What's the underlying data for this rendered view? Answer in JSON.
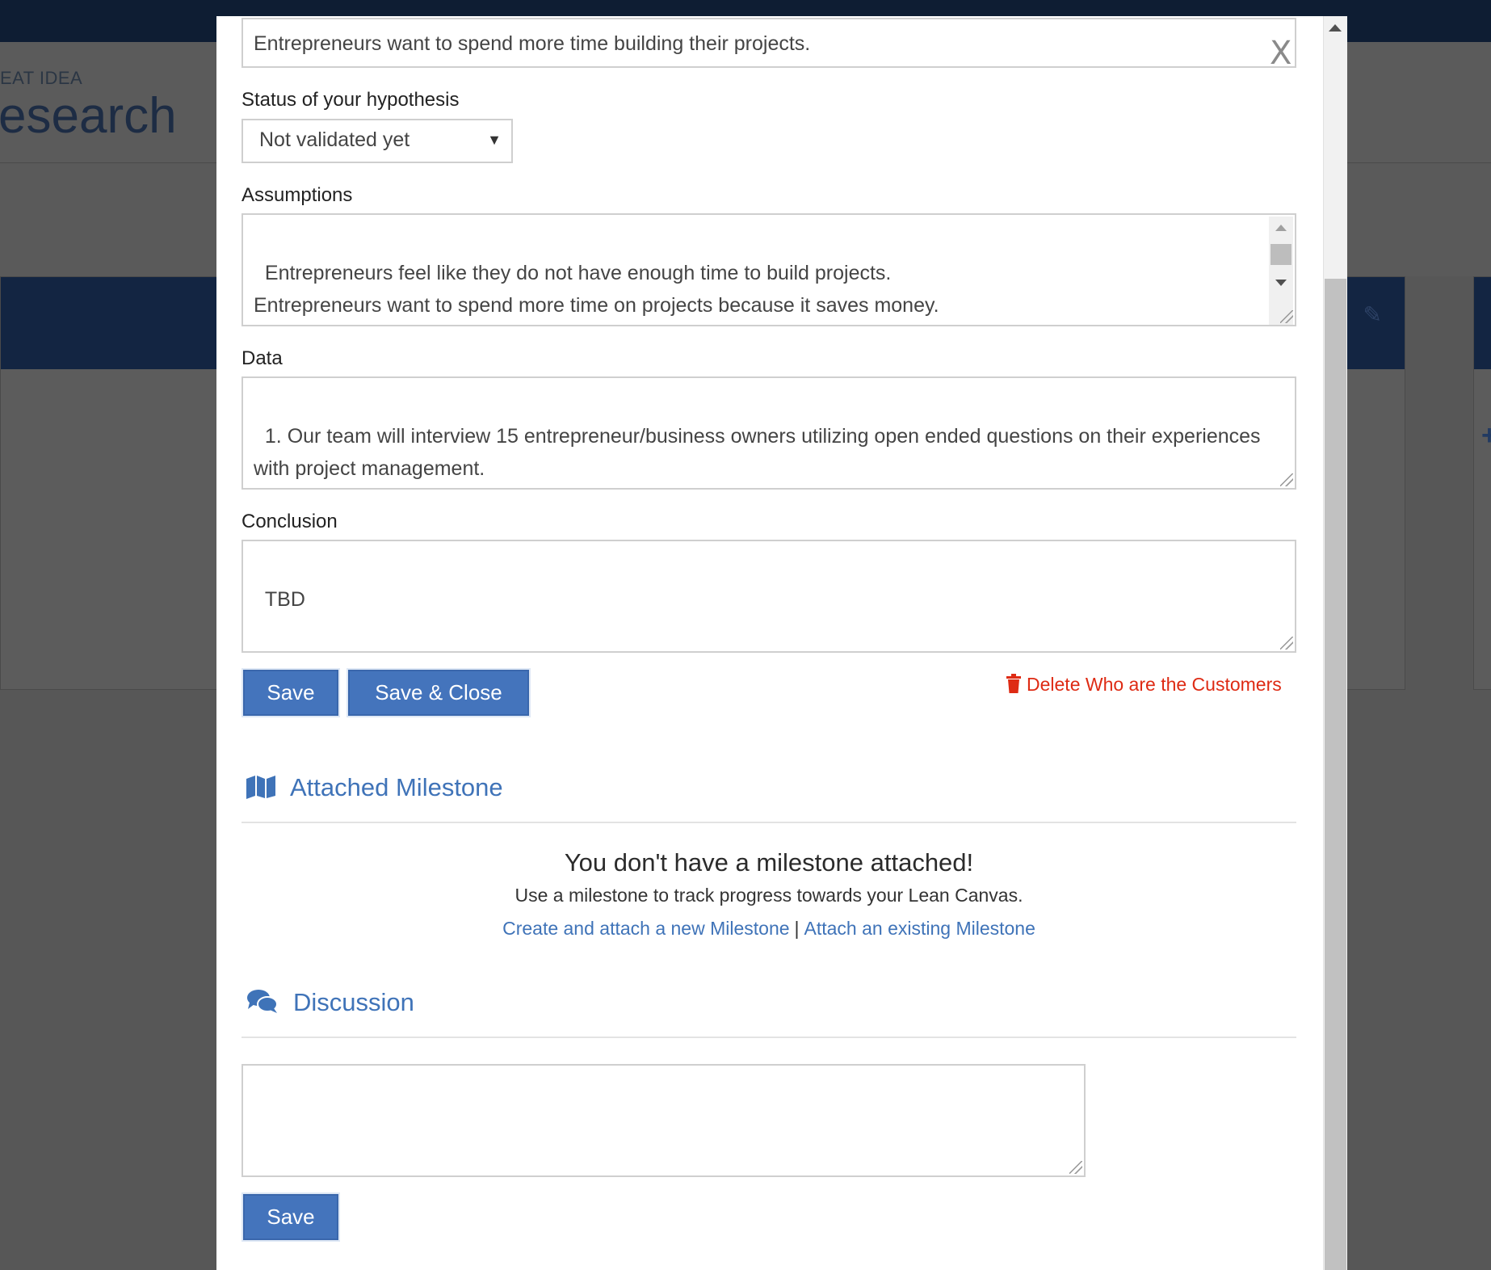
{
  "background": {
    "kicker": "EAT IDEA",
    "title": "esearch"
  },
  "modal": {
    "hypothesis_value": "Entrepreneurs  want to spend more time building their projects.",
    "close_symbol": "X",
    "status": {
      "label": "Status of your hypothesis",
      "selected": "Not validated yet"
    },
    "assumptions": {
      "label": "Assumptions",
      "value": "Entrepreneurs feel like they do not have enough time to build projects.\nEntrepreneurs want to spend more time on projects because it saves money.\nEntrepreneurs find building more enjoyable than planning."
    },
    "data": {
      "label": "Data",
      "value": "1. Our team will interview 15 entrepreneur/business owners utilizing open ended questions on their experiences with project management."
    },
    "conclusion": {
      "label": "Conclusion",
      "value": "TBD"
    },
    "actions": {
      "save": "Save",
      "save_close": "Save & Close",
      "delete": "Delete Who are the Customers"
    },
    "milestone": {
      "heading": "Attached Milestone",
      "empty_title": "You don't have a milestone attached!",
      "empty_sub": "Use a milestone to track progress towards your Lean Canvas.",
      "create_link": "Create and attach a new Milestone",
      "separator": "|",
      "attach_link": "Attach an existing Milestone"
    },
    "discussion": {
      "heading": "Discussion",
      "value": "",
      "save": "Save"
    }
  },
  "colors": {
    "primary": "#4474bc",
    "link": "#3f73b8",
    "danger": "#de2b14",
    "topbar": "#0e1d33"
  },
  "icons": {
    "milestone": "map-icon",
    "discussion": "comments-icon",
    "delete": "trash-icon",
    "select": "caret-down-icon"
  }
}
